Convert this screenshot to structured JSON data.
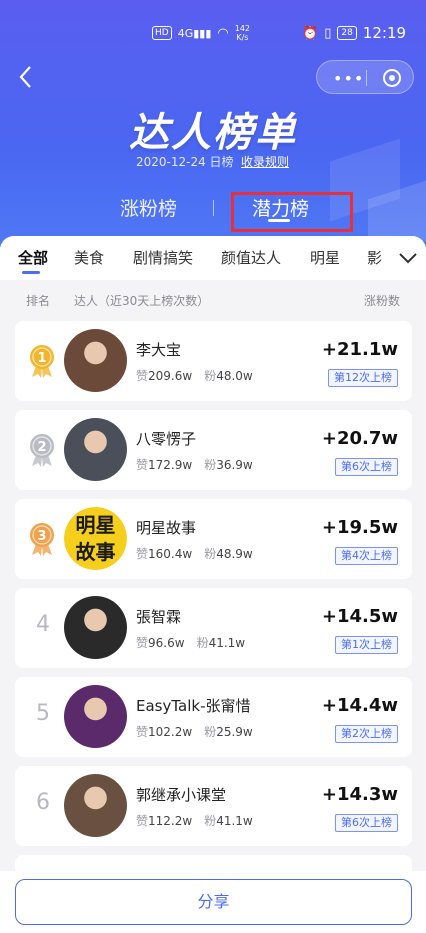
{
  "status_bar": {
    "hd": "HD",
    "signal": "4G",
    "speed_value": "142",
    "speed_unit": "K/s",
    "battery": "28",
    "time": "12:19"
  },
  "header": {
    "title": "达人榜单",
    "date_line": "2020-12-24 日榜",
    "rules_link": "收录规则",
    "tabs": [
      {
        "label": "涨粉榜",
        "active": false
      },
      {
        "label": "潜力榜",
        "active": true
      }
    ]
  },
  "categories": {
    "items": [
      "全部",
      "美食",
      "剧情搞笑",
      "颜值达人",
      "明星",
      "影"
    ],
    "active_index": 0
  },
  "columns": {
    "rank": "排名",
    "creator": "达人（近30天上榜次数）",
    "gain": "涨粉数"
  },
  "stat_labels": {
    "likes": "赞",
    "fans": "粉"
  },
  "rows": [
    {
      "rank": "1",
      "name": "李大宝",
      "likes": "209.6w",
      "fans": "48.0w",
      "gain": "+21.1w",
      "times": "第12次上榜",
      "medal": "gold",
      "avatar_text": ""
    },
    {
      "rank": "2",
      "name": "八零愣子",
      "likes": "172.9w",
      "fans": "36.9w",
      "gain": "+20.7w",
      "times": "第6次上榜",
      "medal": "silver",
      "avatar_text": ""
    },
    {
      "rank": "3",
      "name": "明星故事",
      "likes": "160.4w",
      "fans": "48.9w",
      "gain": "+19.5w",
      "times": "第4次上榜",
      "medal": "bronze",
      "avatar_text": "明星\n故事"
    },
    {
      "rank": "4",
      "name": "張智霖",
      "likes": "96.6w",
      "fans": "41.1w",
      "gain": "+14.5w",
      "times": "第1次上榜",
      "medal": "",
      "avatar_text": ""
    },
    {
      "rank": "5",
      "name": "EasyTalk-张甯惜",
      "likes": "102.2w",
      "fans": "25.9w",
      "gain": "+14.4w",
      "times": "第2次上榜",
      "medal": "",
      "avatar_text": ""
    },
    {
      "rank": "6",
      "name": "郭继承小课堂",
      "likes": "112.2w",
      "fans": "41.1w",
      "gain": "+14.3w",
      "times": "第6次上榜",
      "medal": "",
      "avatar_text": ""
    }
  ],
  "share_label": "分享",
  "colors": {
    "header_blue": "#4a67f2",
    "accent": "#4b6cf5",
    "highlight_red": "#e8303d",
    "gold": "#f3b62a",
    "silver": "#b9bcc4",
    "bronze": "#f0a14c"
  }
}
